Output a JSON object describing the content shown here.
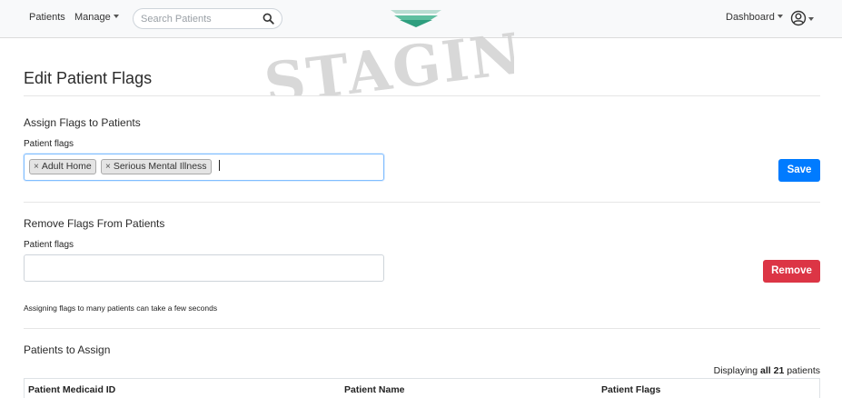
{
  "navbar": {
    "patients_label": "Patients",
    "manage_label": "Manage",
    "search_placeholder": "Search Patients",
    "dashboard_label": "Dashboard"
  },
  "watermark": "STAGING",
  "page": {
    "title": "Edit Patient Flags"
  },
  "assign": {
    "section_title": "Assign Flags to Patients",
    "field_label": "Patient flags",
    "tags": [
      "Adult Home",
      "Serious Mental Illness"
    ],
    "save_label": "Save"
  },
  "remove": {
    "section_title": "Remove Flags From Patients",
    "field_label": "Patient flags",
    "remove_label": "Remove"
  },
  "note": "Assigning flags to many patients can take a few seconds",
  "patients": {
    "section_title": "Patients to Assign",
    "displaying_prefix": "Displaying",
    "displaying_all": "all 21",
    "displaying_suffix": "patients",
    "columns": [
      "Patient Medicaid ID",
      "Patient Name",
      "Patient Flags"
    ]
  },
  "colors": {
    "primary": "#007bff",
    "danger": "#dc3545",
    "logo_green": "#2e9e7e"
  }
}
